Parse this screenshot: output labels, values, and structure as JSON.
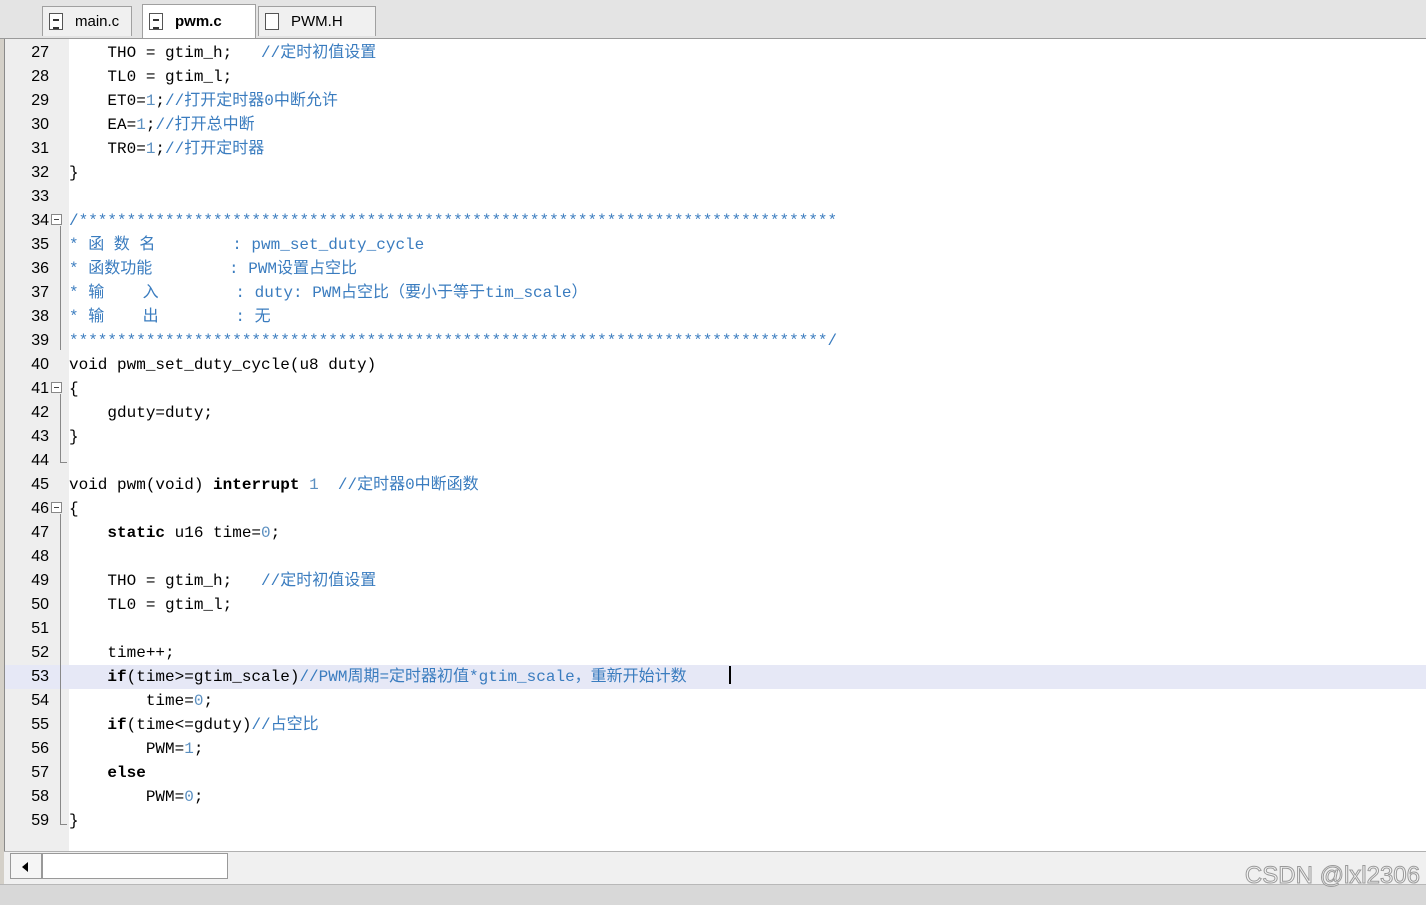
{
  "tabs": [
    {
      "label": "main.c",
      "active": false,
      "icon": "c-file-icon"
    },
    {
      "label": "pwm.c",
      "active": true,
      "icon": "c-file-icon"
    },
    {
      "label": "PWM.H",
      "active": false,
      "icon": "header-file-icon"
    }
  ],
  "editor": {
    "highlight_line": 53,
    "lines": [
      {
        "n": "27",
        "segs": [
          [
            "",
            "    THO = gtim_h;   "
          ],
          [
            "cmt",
            "//定时初值设置"
          ]
        ]
      },
      {
        "n": "28",
        "segs": [
          [
            "",
            "    TL0 = gtim_l;"
          ]
        ]
      },
      {
        "n": "29",
        "segs": [
          [
            "",
            "    ET0="
          ],
          [
            "num",
            "1"
          ],
          [
            "",
            ";"
          ],
          [
            "cmt",
            "//打开定时器0中断允许"
          ]
        ]
      },
      {
        "n": "30",
        "segs": [
          [
            "",
            "    EA="
          ],
          [
            "num",
            "1"
          ],
          [
            "",
            ";"
          ],
          [
            "cmt",
            "//打开总中断"
          ]
        ]
      },
      {
        "n": "31",
        "segs": [
          [
            "",
            "    TR0="
          ],
          [
            "num",
            "1"
          ],
          [
            "",
            ";"
          ],
          [
            "cmt",
            "//打开定时器"
          ]
        ]
      },
      {
        "n": "32",
        "segs": [
          [
            "",
            "}"
          ]
        ]
      },
      {
        "n": "33",
        "segs": []
      },
      {
        "n": "34",
        "segs": [
          [
            "cmt",
            "/*******************************************************************************"
          ]
        ]
      },
      {
        "n": "35",
        "segs": [
          [
            "cmt",
            "* 函 数 名        : pwm_set_duty_cycle"
          ]
        ]
      },
      {
        "n": "36",
        "segs": [
          [
            "cmt",
            "* 函数功能        : PWM设置占空比"
          ]
        ]
      },
      {
        "n": "37",
        "segs": [
          [
            "cmt",
            "* 输    入        : duty: PWM占空比（要小于等于tim_scale）"
          ]
        ]
      },
      {
        "n": "38",
        "segs": [
          [
            "cmt",
            "* 输    出        : 无"
          ]
        ]
      },
      {
        "n": "39",
        "segs": [
          [
            "cmt",
            "*******************************************************************************/"
          ]
        ]
      },
      {
        "n": "40",
        "segs": [
          [
            "",
            "void pwm_set_duty_cycle(u8 duty)"
          ]
        ]
      },
      {
        "n": "41",
        "segs": [
          [
            "",
            "{"
          ]
        ]
      },
      {
        "n": "42",
        "segs": [
          [
            "",
            "    gduty=duty;"
          ]
        ]
      },
      {
        "n": "43",
        "segs": [
          [
            "",
            "}"
          ]
        ]
      },
      {
        "n": "44",
        "segs": []
      },
      {
        "n": "45",
        "segs": [
          [
            "",
            "void pwm(void) "
          ],
          [
            "kw",
            "interrupt"
          ],
          [
            "",
            " "
          ],
          [
            "num",
            "1"
          ],
          [
            "",
            "  "
          ],
          [
            "cmt",
            "//定时器0中断函数"
          ]
        ]
      },
      {
        "n": "46",
        "segs": [
          [
            "",
            "{"
          ]
        ]
      },
      {
        "n": "47",
        "segs": [
          [
            "",
            "    "
          ],
          [
            "kw",
            "static"
          ],
          [
            "",
            " u16 time="
          ],
          [
            "num",
            "0"
          ],
          [
            "",
            ";"
          ]
        ]
      },
      {
        "n": "48",
        "segs": []
      },
      {
        "n": "49",
        "segs": [
          [
            "",
            "    THO = gtim_h;   "
          ],
          [
            "cmt",
            "//定时初值设置"
          ]
        ]
      },
      {
        "n": "50",
        "segs": [
          [
            "",
            "    TL0 = gtim_l;"
          ]
        ]
      },
      {
        "n": "51",
        "segs": []
      },
      {
        "n": "52",
        "segs": [
          [
            "",
            "    time++;"
          ]
        ]
      },
      {
        "n": "53",
        "segs": [
          [
            "",
            "    "
          ],
          [
            "kw",
            "if"
          ],
          [
            "",
            "(time>=gtim_scale)"
          ],
          [
            "cmt",
            "//PWM周期=定时器初值*gtim_scale，重新开始计数"
          ]
        ]
      },
      {
        "n": "54",
        "segs": [
          [
            "",
            "        time="
          ],
          [
            "num",
            "0"
          ],
          [
            "",
            ";"
          ]
        ]
      },
      {
        "n": "55",
        "segs": [
          [
            "",
            "    "
          ],
          [
            "kw",
            "if"
          ],
          [
            "",
            "(time<=gduty)"
          ],
          [
            "cmt",
            "//占空比"
          ]
        ]
      },
      {
        "n": "56",
        "segs": [
          [
            "",
            "        PWM="
          ],
          [
            "num",
            "1"
          ],
          [
            "",
            ";"
          ]
        ]
      },
      {
        "n": "57",
        "segs": [
          [
            "",
            "    "
          ],
          [
            "kw",
            "else"
          ]
        ]
      },
      {
        "n": "58",
        "segs": [
          [
            "",
            "        PWM="
          ],
          [
            "num",
            "0"
          ],
          [
            "",
            ";"
          ]
        ]
      },
      {
        "n": "59",
        "segs": [
          [
            "",
            "}"
          ]
        ]
      }
    ]
  },
  "watermark": "CSDN @lxl2306"
}
